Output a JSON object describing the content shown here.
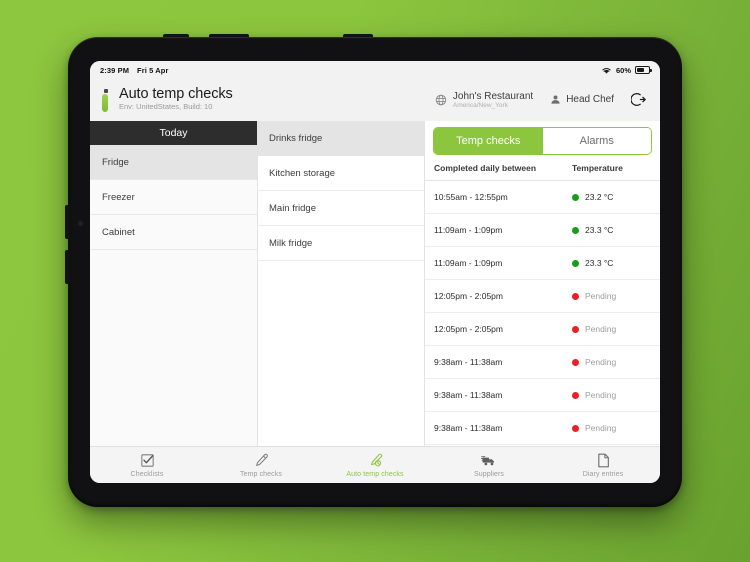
{
  "statusbar": {
    "time": "2:39 PM",
    "date": "Fri 5 Apr",
    "wifi_icon": "wifi-icon",
    "battery_percent": "60%",
    "battery_icon": "battery-icon"
  },
  "header": {
    "logo_icon": "app-logo-i-icon",
    "title": "Auto temp checks",
    "subtitle": "Env: UnitedStates, Build: 10",
    "site_icon": "globe-icon",
    "site_name": "John's  Restaurant",
    "site_timezone": "America/New_York",
    "user_icon": "person-icon",
    "user_role": "Head Chef",
    "logout_icon": "logout-icon"
  },
  "groups_column": {
    "header": "Today",
    "items": [
      {
        "label": "Fridge",
        "selected": true
      },
      {
        "label": "Freezer",
        "selected": false
      },
      {
        "label": "Cabinet",
        "selected": false
      }
    ]
  },
  "units_column": {
    "items": [
      {
        "label": "Drinks fridge",
        "selected": true
      },
      {
        "label": "Kitchen storage",
        "selected": false
      },
      {
        "label": "Main fridge",
        "selected": false
      },
      {
        "label": "Milk fridge",
        "selected": false
      }
    ]
  },
  "detail": {
    "tabs": [
      {
        "label": "Temp checks",
        "active": true
      },
      {
        "label": "Alarms",
        "active": false
      }
    ],
    "columns": {
      "time": "Completed daily between",
      "temperature": "Temperature"
    },
    "rows": [
      {
        "time": "10:55am - 12:55pm",
        "value": "23.2 °C",
        "status": "ok"
      },
      {
        "time": "11:09am - 1:09pm",
        "value": "23.3 °C",
        "status": "ok"
      },
      {
        "time": "11:09am - 1:09pm",
        "value": "23.3 °C",
        "status": "ok"
      },
      {
        "time": "12:05pm - 2:05pm",
        "value": "Pending",
        "status": "pending"
      },
      {
        "time": "12:05pm - 2:05pm",
        "value": "Pending",
        "status": "pending"
      },
      {
        "time": "9:38am - 11:38am",
        "value": "Pending",
        "status": "pending"
      },
      {
        "time": "9:38am - 11:38am",
        "value": "Pending",
        "status": "pending"
      },
      {
        "time": "9:38am - 11:38am",
        "value": "Pending",
        "status": "pending"
      }
    ]
  },
  "bottom_nav": [
    {
      "label": "Checklists",
      "icon": "checklist-icon",
      "active": false
    },
    {
      "label": "Temp checks",
      "icon": "thermometer-pen-icon",
      "active": false
    },
    {
      "label": "Auto temp checks",
      "icon": "auto-temp-icon",
      "active": true
    },
    {
      "label": "Suppliers",
      "icon": "truck-icon",
      "active": false
    },
    {
      "label": "Diary entries",
      "icon": "note-icon",
      "active": false
    }
  ],
  "colors": {
    "brand_green": "#8cc63e",
    "status_ok": "#1a9e1a",
    "status_pending": "#e8202a",
    "header_dark": "#2d2d2d",
    "background": "#8dc63f"
  }
}
